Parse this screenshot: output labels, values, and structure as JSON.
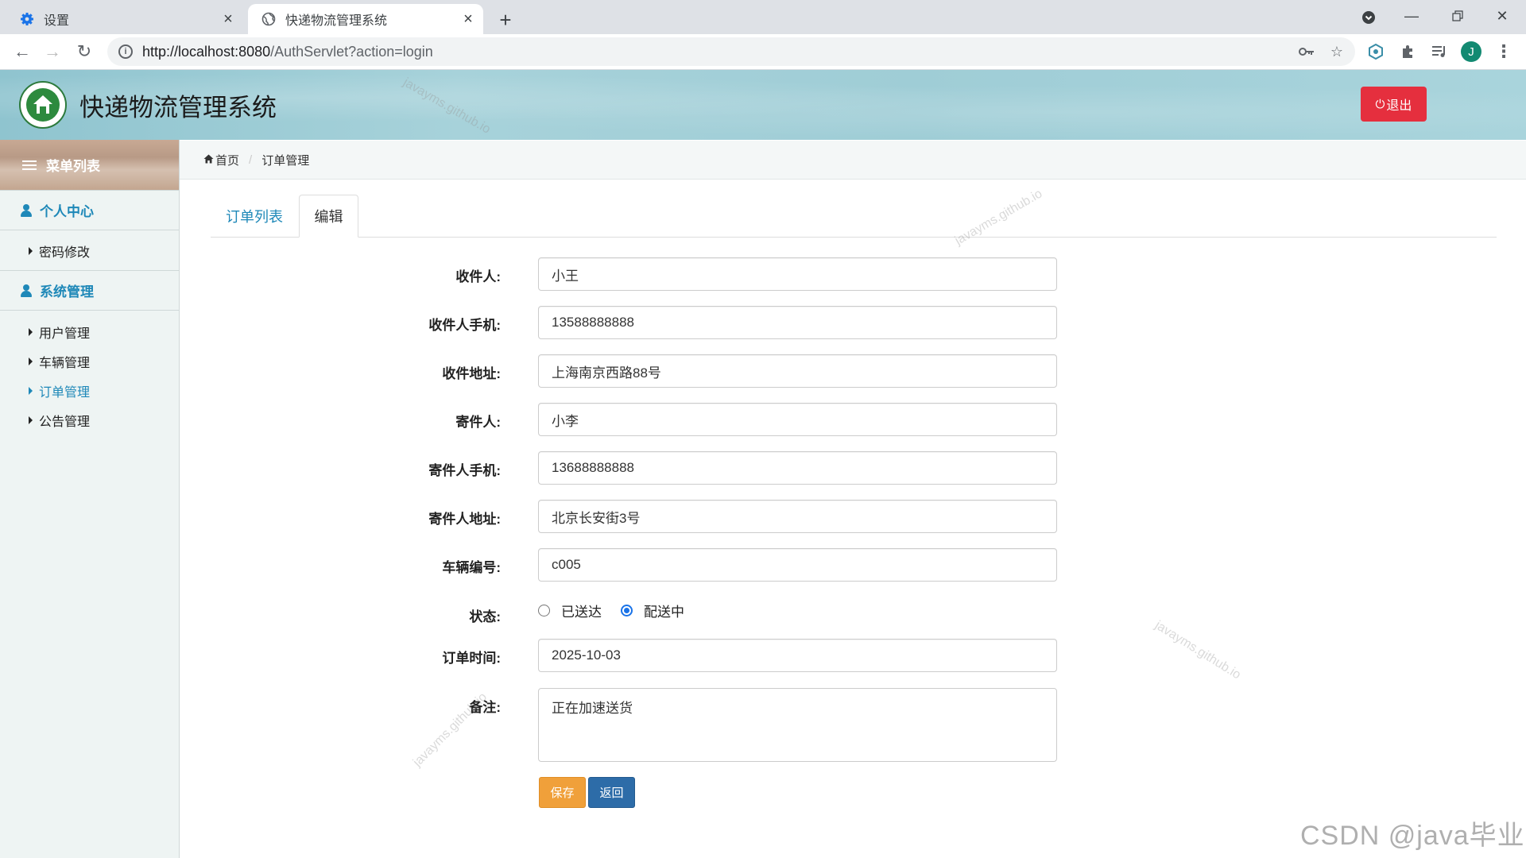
{
  "browser": {
    "tabs": [
      {
        "title": "设置",
        "icon": "gear-icon",
        "active": false
      },
      {
        "title": "快递物流管理系统",
        "icon": "globe-icon",
        "active": true
      }
    ],
    "url_host": "http://localhost:8080",
    "url_path": "/AuthServlet?action=login",
    "profile_initial": "J"
  },
  "header": {
    "title": "快递物流管理系统",
    "logout_label": "退出"
  },
  "sidebar": {
    "menu_title": "菜单列表",
    "sections": [
      {
        "title": "个人中心",
        "items": [
          "密码修改"
        ]
      },
      {
        "title": "系统管理",
        "items": [
          "用户管理",
          "车辆管理",
          "订单管理",
          "公告管理"
        ]
      }
    ],
    "active_item": "订单管理"
  },
  "breadcrumb": {
    "home": "首页",
    "current": "订单管理"
  },
  "tabs": {
    "list": "订单列表",
    "edit": "编辑",
    "active": "编辑"
  },
  "form": {
    "fields": [
      {
        "label": "收件人:",
        "value": "小王"
      },
      {
        "label": "收件人手机:",
        "value": "13588888888"
      },
      {
        "label": "收件地址:",
        "value": "上海南京西路88号"
      },
      {
        "label": "寄件人:",
        "value": "小李"
      },
      {
        "label": "寄件人手机:",
        "value": "13688888888"
      },
      {
        "label": "寄件人地址:",
        "value": "北京长安街3号"
      },
      {
        "label": "车辆编号:",
        "value": "c005"
      }
    ],
    "status": {
      "label": "状态:",
      "options": [
        "已送达",
        "配送中"
      ],
      "selected": "配送中"
    },
    "order_time": {
      "label": "订单时间:",
      "value": "2025-10-03"
    },
    "remark": {
      "label": "备注:",
      "value": "正在加速送货"
    },
    "save_label": "保存",
    "back_label": "返回"
  },
  "watermark": {
    "site": "javayms.github.io",
    "csdn": "CSDN @java毕业"
  },
  "colors": {
    "accent": "#1e88b8",
    "logout": "#e52f3e",
    "save": "#f0a03a",
    "back": "#2d6ca8"
  }
}
